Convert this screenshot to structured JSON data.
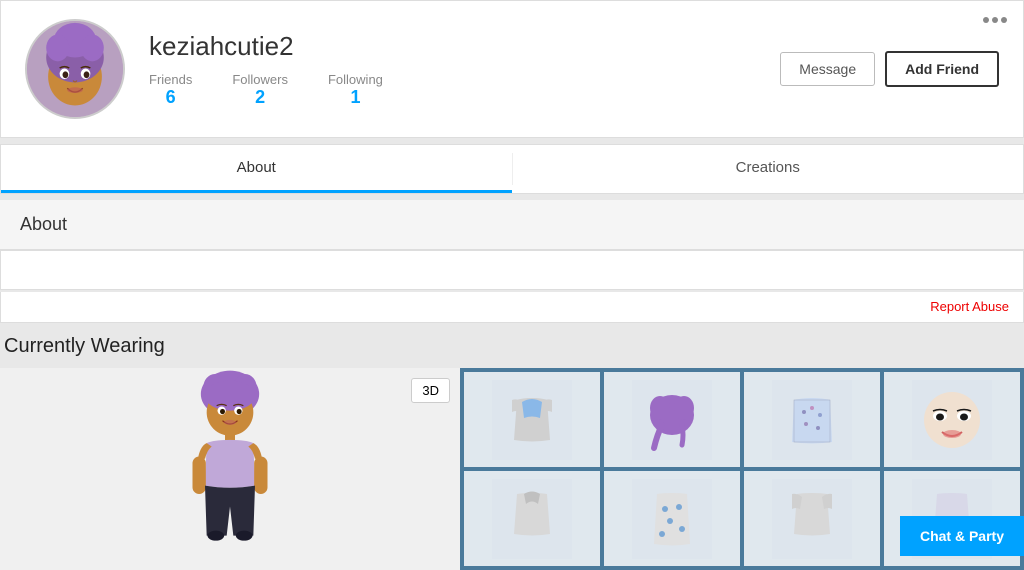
{
  "profile": {
    "username": "keziahcutie2",
    "stats": {
      "friends_label": "Friends",
      "friends_value": "6",
      "followers_label": "Followers",
      "followers_value": "2",
      "following_label": "Following",
      "following_value": "1"
    },
    "actions": {
      "message_label": "Message",
      "add_friend_label": "Add Friend"
    }
  },
  "tabs": {
    "about_label": "About",
    "creations_label": "Creations"
  },
  "about": {
    "title": "About",
    "report_abuse_label": "Report Abuse"
  },
  "wearing": {
    "title": "Currently Wearing",
    "btn_3d_label": "3D",
    "chat_party_label": "Chat & Party"
  },
  "icons": {
    "more_icon": "⋯"
  }
}
